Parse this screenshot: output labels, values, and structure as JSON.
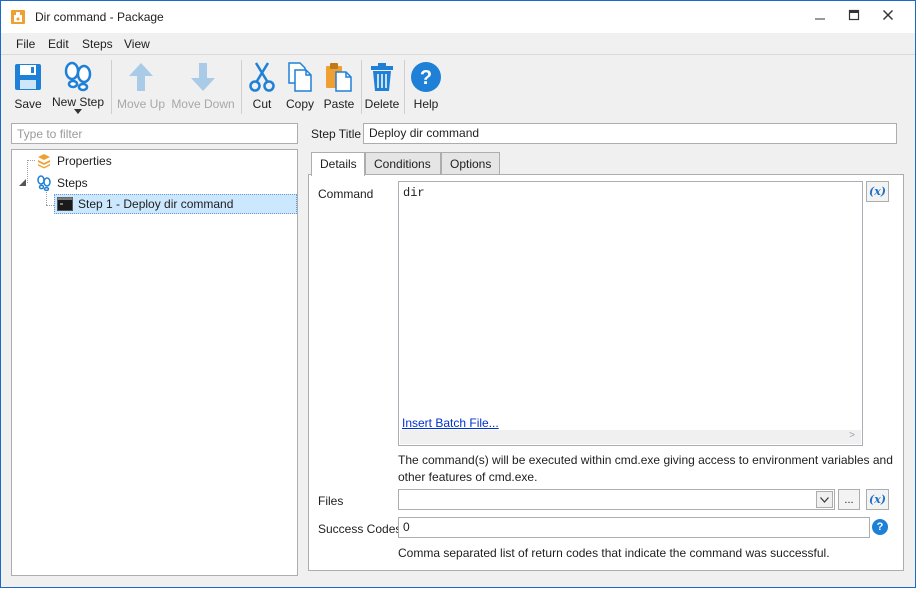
{
  "window": {
    "title": "Dir command - Package",
    "minimize_glyph": "—",
    "close_glyph": "✕"
  },
  "menu": {
    "items": [
      "File",
      "Edit",
      "Steps",
      "View"
    ]
  },
  "toolbar": {
    "save": "Save",
    "new_step": "New Step",
    "move_up": "Move Up",
    "move_down": "Move Down",
    "cut": "Cut",
    "copy": "Copy",
    "paste": "Paste",
    "delete": "Delete",
    "help": "Help"
  },
  "filter": {
    "placeholder": "Type to filter"
  },
  "tree": {
    "properties": "Properties",
    "steps": "Steps",
    "step1": "Step 1 - Deploy dir command"
  },
  "step": {
    "title_label": "Step Title",
    "title_value": "Deploy dir command"
  },
  "tabs": [
    "Details",
    "Conditions",
    "Options"
  ],
  "details": {
    "command_label": "Command",
    "command_value": "dir",
    "insert_link": "Insert Batch File...",
    "var_label": "(x)",
    "command_help": "The command(s) will be executed within cmd.exe giving access to environment variables and other features of cmd.exe.",
    "files_label": "Files",
    "files_value": "",
    "browse_label": "...",
    "success_label": "Success Codes",
    "success_value": "0",
    "success_help": "Comma separated list of return codes that indicate the command was successful.",
    "help_glyph": "?"
  },
  "colors": {
    "accent": "#1f80d8",
    "selection": "#cce8ff",
    "link": "#0033cc",
    "disabled_icon": "#a9cbe8",
    "orange": "#f0a030"
  }
}
